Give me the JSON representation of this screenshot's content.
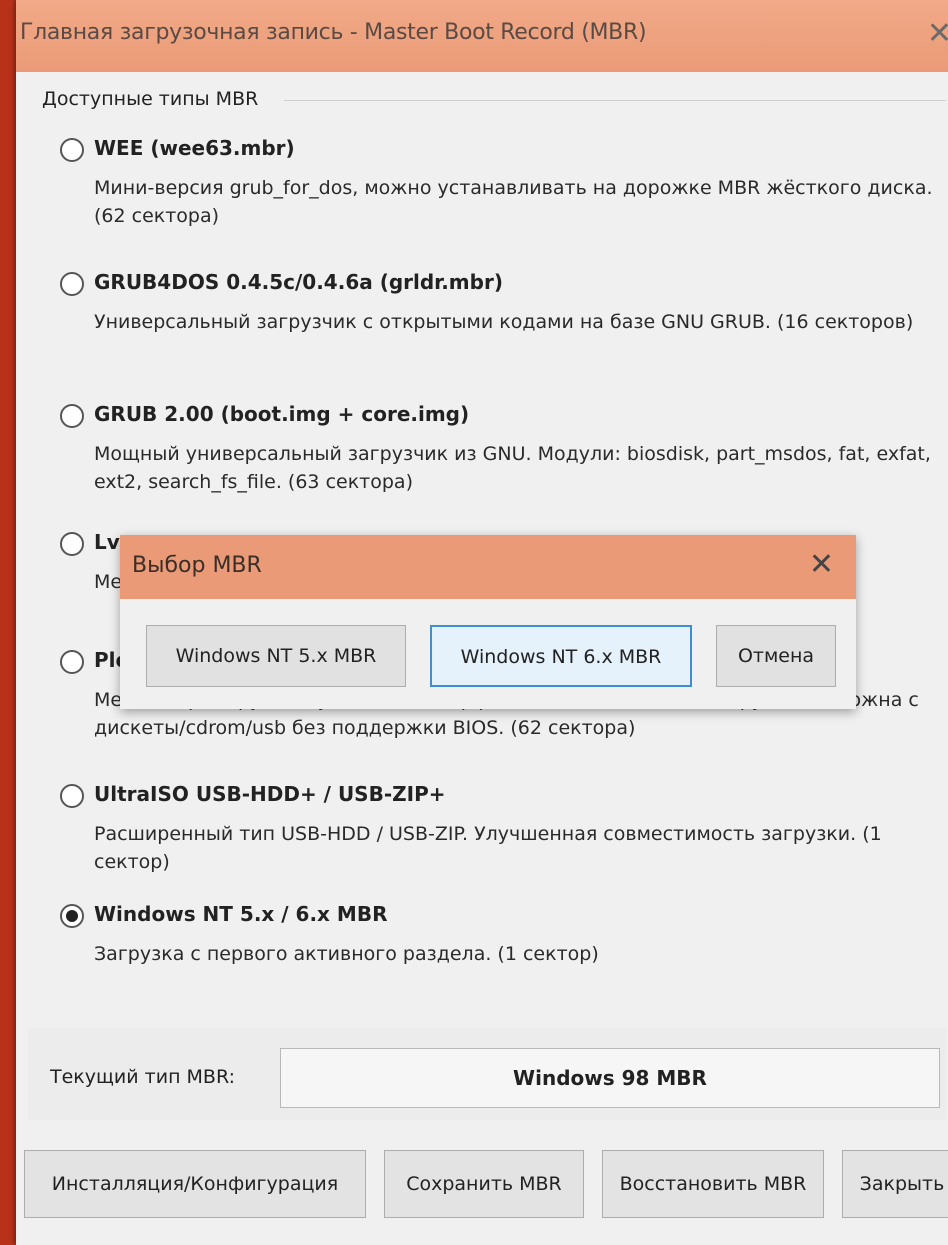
{
  "window": {
    "title": "Главная загрузочная запись - Master Boot Record (MBR)",
    "close_glyph": "✕"
  },
  "group": {
    "label": "Доступные типы MBR"
  },
  "options": [
    {
      "label": "WEE (wee63.mbr)",
      "description": "Мини-версия grub_for_dos, можно устанавливать на дорожке MBR жёсткого диска. (62 сектора)",
      "selected": false
    },
    {
      "label": "GRUB4DOS 0.4.5c/0.4.6a (grldr.mbr)",
      "description": "Универсальный загрузчик с открытыми кодами на базе GNU GRUB. (16 секторов)",
      "selected": false
    },
    {
      "label": "GRUB 2.00 (boot.img + core.img)",
      "description": "Мощный универсальный загрузчик из GNU.  Модули: biosdisk, part_msdos, fat, exfat, ext2, search_fs_file. (63 сектора)",
      "selected": false
    },
    {
      "label": "Lv",
      "description": "Ме ин",
      "selected": false
    },
    {
      "label": "Plo",
      "description": "Менеджер загрузки с удобным интерфейсом пользователя. Загрузка возможна с дискеты/cdrom/usb без поддержки BIOS. (62 сектора)",
      "selected": false
    },
    {
      "label": "UltraISO USB-HDD+ / USB-ZIP+",
      "description": "Расширенный тип USB-HDD / USB-ZIP. Улучшенная совместимость загрузки. (1 сектор)",
      "selected": false
    },
    {
      "label": "Windows NT 5.x / 6.x MBR",
      "description": "Загрузка с первого активного раздела. (1 сектор)",
      "selected": true
    }
  ],
  "current": {
    "label": "Текущий тип MBR:",
    "value": "Windows 98 MBR"
  },
  "buttons": {
    "install": "Инсталляция/Конфигурация",
    "save": "Сохранить MBR",
    "restore": "Восстановить MBR",
    "close": "Закрыть"
  },
  "dialog": {
    "title": "Выбор MBR",
    "close_glyph": "✕",
    "nt5": "Windows NT 5.x MBR",
    "nt6": "Windows NT 6.x MBR",
    "cancel": "Отмена"
  },
  "colors": {
    "titlebar": "#ea9a76",
    "desktop": "#c83a1c",
    "default_button_border": "#3c8fd4"
  }
}
